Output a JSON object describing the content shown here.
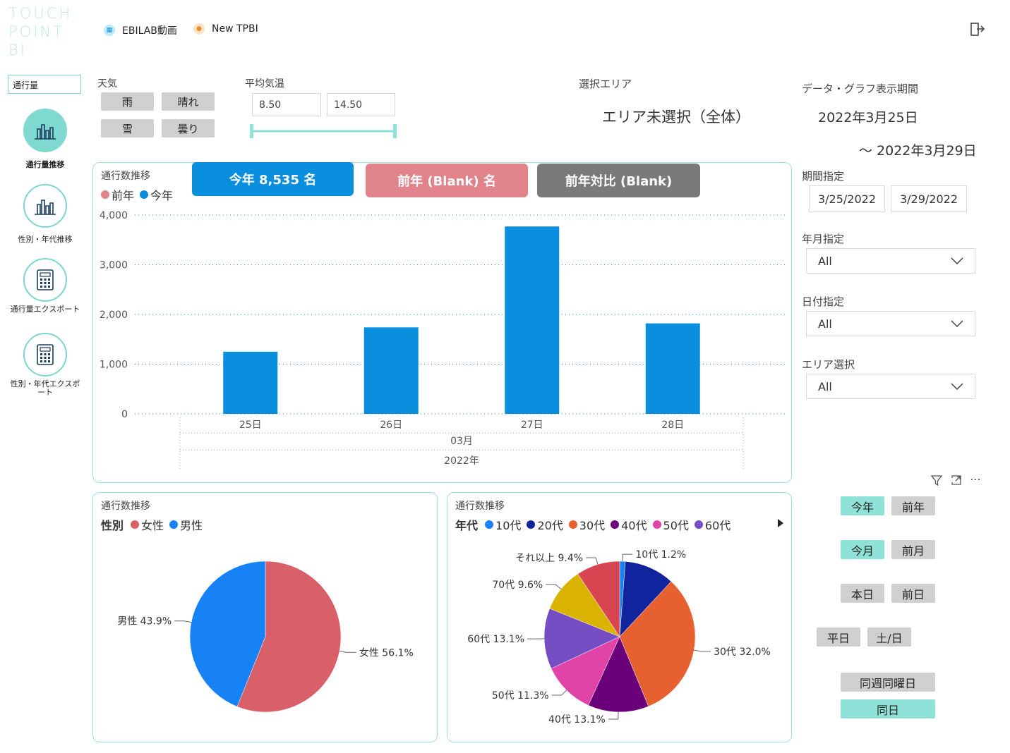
{
  "logo": {
    "line1": "TOUCH",
    "line2": "POINT",
    "line3": "BI"
  },
  "top_links": [
    {
      "label": "EBILAB動画"
    },
    {
      "label": "New TPBI"
    }
  ],
  "nav": {
    "select_value": "通行量",
    "items": [
      {
        "label": "通行量推移",
        "active": true
      },
      {
        "label": "性別・年代推移"
      },
      {
        "label": "通行量エクスポート"
      },
      {
        "label": "性別・年代エクスポート"
      }
    ]
  },
  "filters": {
    "weather_label": "天気",
    "weather": [
      "雨",
      "晴れ",
      "雪",
      "曇り"
    ],
    "temp_label": "平均気温",
    "temp_min": "8.50",
    "temp_max": "14.50"
  },
  "area": {
    "label": "選択エリア",
    "value": "エリア未選択（全体）"
  },
  "period": {
    "label": "データ・グラフ表示期間",
    "from": "2022年3月25日",
    "to": "～ 2022年3月29日",
    "range_label": "期間指定",
    "start": "3/25/2022",
    "end": "3/29/2022",
    "ym_label": "年月指定",
    "ym_value": "All",
    "day_label": "日付指定",
    "day_value": "All",
    "area_label": "エリア選択",
    "area_value": "All"
  },
  "kpis": {
    "this_year": "今年 8,535 名",
    "last_year": "前年 (Blank) 名",
    "yoy": "前年対比 (Blank)"
  },
  "colors": {
    "this_year": "#0a8fde",
    "last_year": "#e0838b",
    "yoy": "#7a7a7a",
    "accent": "#8ee2d8",
    "female": "#d95f69",
    "male": "#1782f5"
  },
  "traffic_chart": {
    "title": "通行数推移",
    "legend": [
      "前年",
      "今年"
    ]
  },
  "gender_chart": {
    "title": "通行数推移",
    "legend_title": "性別",
    "legend": [
      "女性",
      "男性"
    ]
  },
  "age_chart": {
    "title": "通行数推移",
    "legend_title": "年代",
    "legend": [
      "10代",
      "20代",
      "30代",
      "40代",
      "50代",
      "60代"
    ]
  },
  "quick_buttons": {
    "this_year": "今年",
    "last_year": "前年",
    "this_month": "今月",
    "last_month": "前月",
    "today": "本日",
    "prev_day": "前日",
    "weekday": "平日",
    "weekend": "土/日",
    "same_week": "同週同曜日",
    "same_day": "同日"
  },
  "chart_data": [
    {
      "type": "bar",
      "title": "通行数推移",
      "categories": [
        "25日",
        "26日",
        "27日",
        "28日"
      ],
      "x_group_month": "03月",
      "x_group_year": "2022年",
      "series": [
        {
          "name": "前年",
          "values": [
            null,
            null,
            null,
            null
          ]
        },
        {
          "name": "今年",
          "values": [
            1250,
            1740,
            3770,
            1820
          ]
        }
      ],
      "ylim": [
        0,
        4000
      ],
      "yticks": [
        0,
        1000,
        2000,
        3000,
        4000
      ],
      "ytick_labels": [
        "0",
        "1,000",
        "2,000",
        "3,000",
        "4,000"
      ],
      "grid": true
    },
    {
      "type": "pie",
      "title": "通行数推移",
      "legend_title": "性別",
      "slices": [
        {
          "label": "女性 56.1%",
          "value": 56.1,
          "color": "#d95f69"
        },
        {
          "label": "男性 43.9%",
          "value": 43.9,
          "color": "#1782f5"
        }
      ]
    },
    {
      "type": "pie",
      "title": "通行数推移",
      "legend_title": "年代",
      "slices": [
        {
          "label": "10代 1.2%",
          "value": 1.2,
          "color": "#1782f5"
        },
        {
          "label": "20代",
          "value": 10.8,
          "color": "#12239e"
        },
        {
          "label": "30代 32.0%",
          "value": 32.0,
          "color": "#e66030"
        },
        {
          "label": "40代 13.1%",
          "value": 13.1,
          "color": "#6b007b"
        },
        {
          "label": "50代 11.3%",
          "value": 11.3,
          "color": "#e044a7"
        },
        {
          "label": "60代 13.1%",
          "value": 13.1,
          "color": "#744ec2"
        },
        {
          "label": "70代 9.6%",
          "value": 9.6,
          "color": "#d9b300"
        },
        {
          "label": "それ以上 9.4%",
          "value": 9.4,
          "color": "#d64550"
        }
      ]
    }
  ]
}
